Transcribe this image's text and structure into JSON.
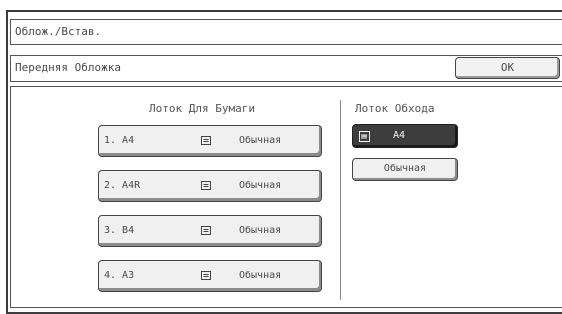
{
  "window": {
    "title": "Облож./Встав."
  },
  "header": {
    "title": "Передняя Обложка",
    "ok_label": "OK"
  },
  "paper_tray": {
    "title": "Лоток Для Бумаги",
    "trays": [
      {
        "label": "1. A4",
        "type": "Обычная",
        "icon": "paper-tray-icon"
      },
      {
        "label": "2. A4R",
        "type": "Обычная",
        "icon": "paper-tray-icon"
      },
      {
        "label": "3. B4",
        "type": "Обычная",
        "icon": "paper-tray-icon"
      },
      {
        "label": "4. A3",
        "type": "Обычная",
        "icon": "paper-tray-icon"
      }
    ]
  },
  "bypass_tray": {
    "title": "Лоток Обхода",
    "size": "A4",
    "size_icon": "bypass-tray-icon",
    "type": "Обычная"
  }
}
